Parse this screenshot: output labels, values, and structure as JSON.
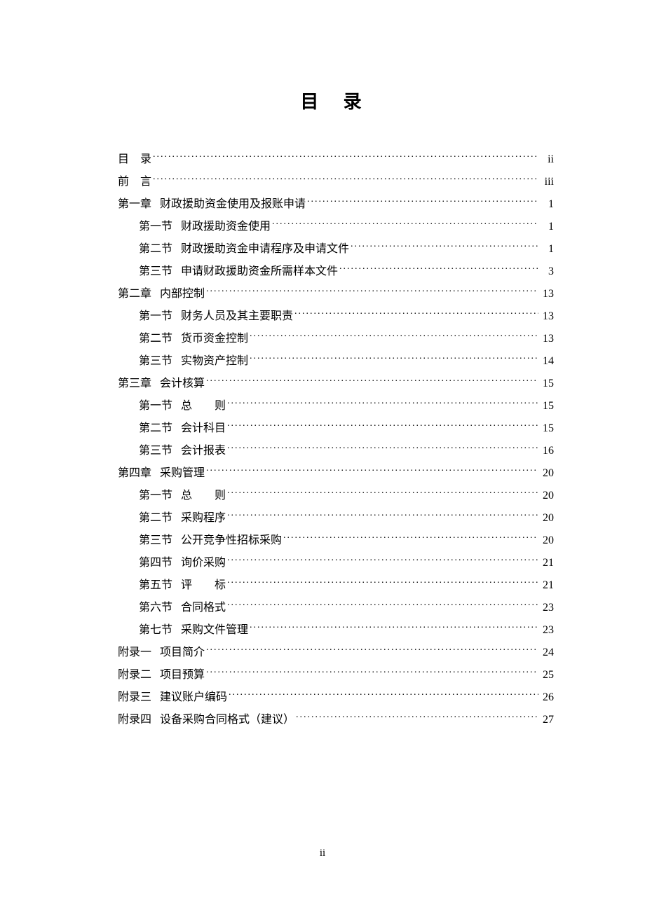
{
  "title": "目 录",
  "page_number": "ii",
  "toc": [
    {
      "level": 1,
      "label": "目",
      "label_spaced": true,
      "text": "录",
      "text_nomargin": true,
      "page": "ii"
    },
    {
      "level": 1,
      "label": "前",
      "label_spaced": true,
      "text": "言",
      "text_nomargin": true,
      "page": "iii"
    },
    {
      "level": 1,
      "label": "第一章",
      "text": "财政援助资金使用及报账申请",
      "page": "1"
    },
    {
      "level": 2,
      "label": "第一节",
      "text": "财政援助资金使用",
      "page": "1"
    },
    {
      "level": 2,
      "label": "第二节",
      "text": "财政援助资金申请程序及申请文件",
      "page": "1"
    },
    {
      "level": 2,
      "label": "第三节",
      "text": "申请财政援助资金所需样本文件",
      "page": "3"
    },
    {
      "level": 1,
      "label": "第二章",
      "text": "内部控制",
      "page": "13"
    },
    {
      "level": 2,
      "label": "第一节",
      "text": "财务人员及其主要职责",
      "page": "13"
    },
    {
      "level": 2,
      "label": "第二节",
      "text": "货币资金控制",
      "page": "13"
    },
    {
      "level": 2,
      "label": "第三节",
      "text": "实物资产控制",
      "page": "14"
    },
    {
      "level": 1,
      "label": "第三章",
      "text": "会计核算",
      "page": "15"
    },
    {
      "level": 2,
      "label": "第一节",
      "text": "总",
      "text_wide": true,
      "text2": "则",
      "page": "15"
    },
    {
      "level": 2,
      "label": "第二节",
      "text": "会计科目",
      "page": "15"
    },
    {
      "level": 2,
      "label": "第三节",
      "text": "会计报表",
      "page": "16"
    },
    {
      "level": 1,
      "label": "第四章",
      "text": "采购管理",
      "page": "20"
    },
    {
      "level": 2,
      "label": "第一节",
      "text": "总",
      "text_wide": true,
      "text2": "则",
      "page": "20"
    },
    {
      "level": 2,
      "label": "第二节",
      "text": "采购程序",
      "page": "20"
    },
    {
      "level": 2,
      "label": "第三节",
      "text": "公开竞争性招标采购",
      "page": "20"
    },
    {
      "level": 2,
      "label": "第四节",
      "text": "询价采购",
      "page": "21"
    },
    {
      "level": 2,
      "label": "第五节",
      "text": "评",
      "text_wide": true,
      "text2": "标",
      "page": "21"
    },
    {
      "level": 2,
      "label": "第六节",
      "text": "合同格式",
      "page": "23"
    },
    {
      "level": 2,
      "label": "第七节",
      "text": "采购文件管理",
      "page": "23"
    },
    {
      "level": 1,
      "label": "附录一",
      "text": "项目简介",
      "page": "24"
    },
    {
      "level": 1,
      "label": "附录二",
      "text": "项目预算",
      "page": "25"
    },
    {
      "level": 1,
      "label": "附录三",
      "text": "建议账户编码",
      "page": "26"
    },
    {
      "level": 1,
      "label": "附录四",
      "text": "设备采购合同格式（建议）",
      "page": "27"
    }
  ]
}
